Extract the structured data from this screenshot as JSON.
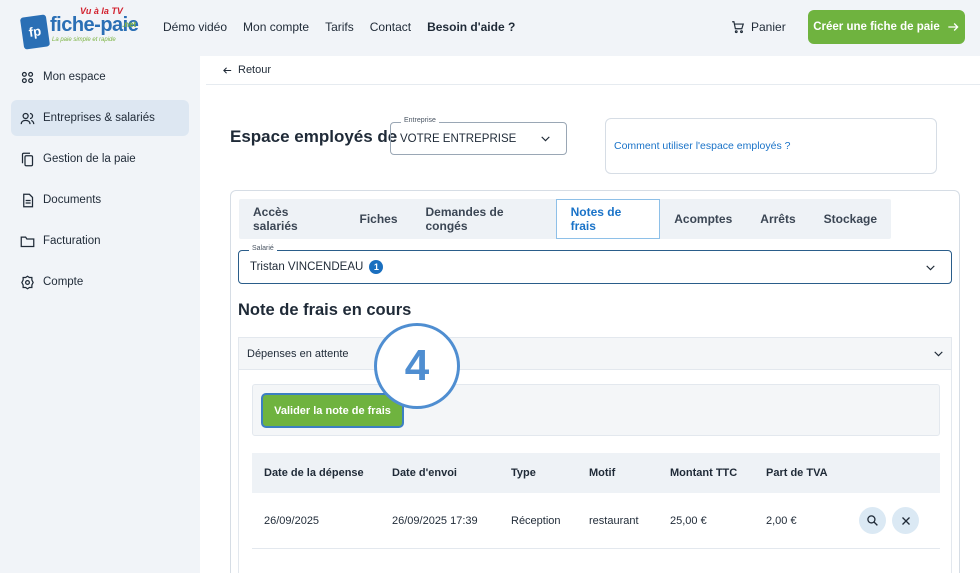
{
  "logo": {
    "box": "fp",
    "name": "fiche-paie",
    "tv": "Vu à la TV",
    "net": ".net",
    "tagline": "La paie simple et rapide"
  },
  "nav": [
    "Démo vidéo",
    "Mon compte",
    "Tarifs",
    "Contact",
    "Besoin d'aide ?"
  ],
  "header": {
    "cart_label": "Panier",
    "cta_label": "Créer une fiche de paie"
  },
  "sidebar": {
    "items": [
      {
        "label": "Mon espace",
        "icon": "grid-icon"
      },
      {
        "label": "Entreprises & salariés",
        "icon": "users-icon"
      },
      {
        "label": "Gestion de la paie",
        "icon": "documents-icon"
      },
      {
        "label": "Documents",
        "icon": "document-icon"
      },
      {
        "label": "Facturation",
        "icon": "folder-icon"
      },
      {
        "label": "Compte",
        "icon": "gear-icon"
      }
    ]
  },
  "main": {
    "back_label": "Retour",
    "espace_title": "Espace employés de",
    "entreprise": {
      "label": "Entreprise",
      "value": "VOTRE ENTREPRISE"
    },
    "help_link": "Comment utiliser l'espace employés ?",
    "tabs": [
      "Accès salariés",
      "Fiches",
      "Demandes de congés",
      "Notes de frais",
      "Acomptes",
      "Arrêts",
      "Stockage"
    ],
    "salarie": {
      "label": "Salarié",
      "value": "Tristan VINCENDEAU",
      "badge": "1"
    },
    "section_title": "Note de frais en cours",
    "accordion_title": "Dépenses en attente",
    "validate_label": "Valider la note de frais",
    "table": {
      "headers": [
        "Date de la dépense",
        "Date d'envoi",
        "Type",
        "Motif",
        "Montant TTC",
        "Part de TVA"
      ],
      "rows": [
        [
          "26/09/2025",
          "26/09/2025 17:39",
          "Réception",
          "restaurant",
          "25,00 €",
          "2,00 €"
        ]
      ]
    }
  },
  "step_marker": "4",
  "colors": {
    "accent_green": "#6fb33f",
    "accent_blue": "#1a73c8",
    "marker_blue": "#4f8ed1"
  }
}
